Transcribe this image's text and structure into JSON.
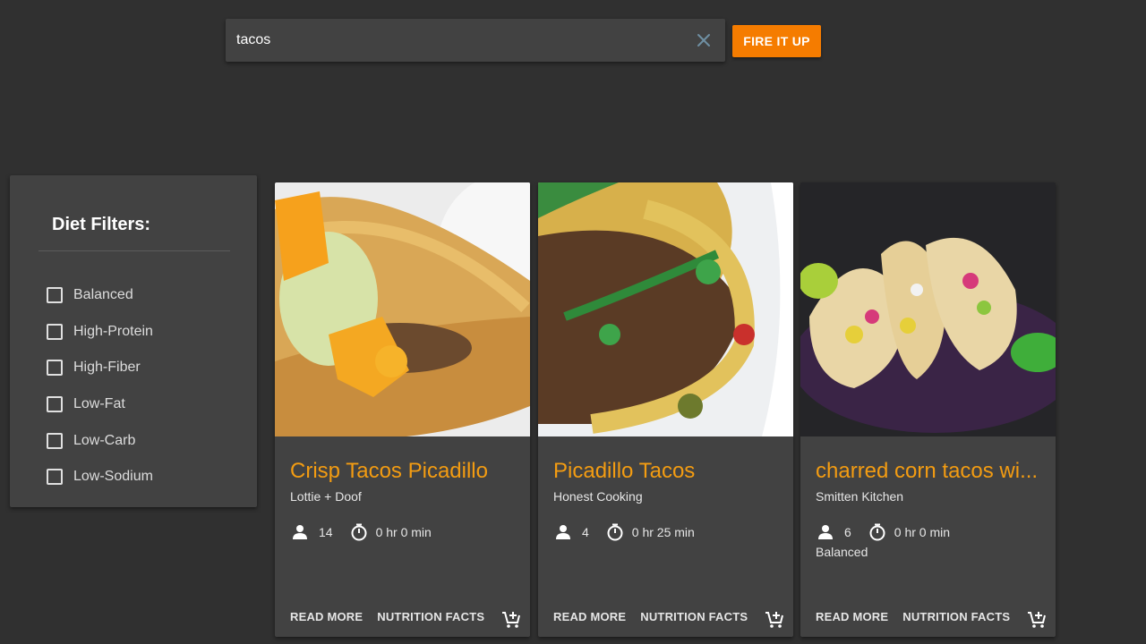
{
  "search": {
    "value": "tacos",
    "placeholder": ""
  },
  "search_button_label": "FIRE IT UP",
  "filters": {
    "title": "Diet Filters:",
    "items": [
      {
        "label": "Balanced",
        "checked": false
      },
      {
        "label": "High-Protein",
        "checked": false
      },
      {
        "label": "High-Fiber",
        "checked": false
      },
      {
        "label": "Low-Fat",
        "checked": false
      },
      {
        "label": "Low-Carb",
        "checked": false
      },
      {
        "label": "Low-Sodium",
        "checked": false
      }
    ]
  },
  "cards": [
    {
      "title": "Crisp Tacos Picadillo",
      "source": "Lottie + Doof",
      "servings": "14",
      "time": "0 hr 0 min",
      "diet": "",
      "read_more": "READ MORE",
      "nutrition": "NUTRITION FACTS"
    },
    {
      "title": "Picadillo Tacos",
      "source": "Honest Cooking",
      "servings": "4",
      "time": "0 hr 25 min",
      "diet": "",
      "read_more": "READ MORE",
      "nutrition": "NUTRITION FACTS"
    },
    {
      "title": "charred corn tacos wi...",
      "source": "Smitten Kitchen",
      "servings": "6",
      "time": "0 hr 0 min",
      "diet": "Balanced",
      "read_more": "READ MORE",
      "nutrition": "NUTRITION FACTS"
    }
  ],
  "colors": {
    "accent": "#f57c00",
    "title": "#f39c12",
    "background": "#303030",
    "surface": "#424242"
  },
  "icons": {
    "clear": "close-icon",
    "servings": "person-icon",
    "time": "timer-icon",
    "cart": "add-shopping-cart-icon"
  }
}
